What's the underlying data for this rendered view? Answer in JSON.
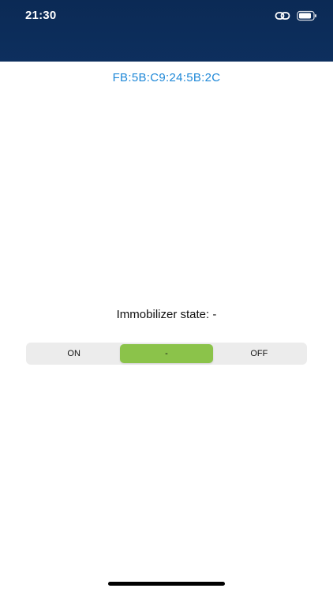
{
  "status_bar": {
    "time": "21:30",
    "icons": [
      "link-icon",
      "battery-icon"
    ]
  },
  "device": {
    "id": "FB:5B:C9:24:5B:2C"
  },
  "immobilizer": {
    "label": "Immobilizer state: -",
    "segments": [
      {
        "label": "ON"
      },
      {
        "label": "-"
      },
      {
        "label": "OFF"
      }
    ],
    "selected_segment": "-"
  },
  "colors": {
    "header": "#0d2f5e",
    "accent": "#1e88d8",
    "selected": "#8bc34a"
  }
}
